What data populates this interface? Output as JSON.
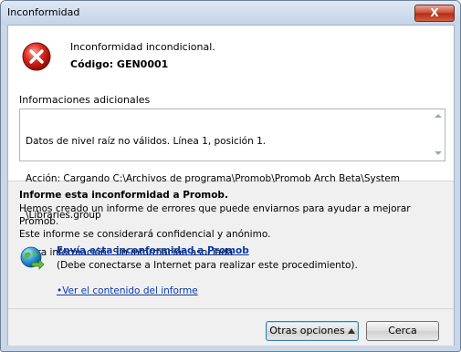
{
  "window": {
    "title": "Inconformidad",
    "close_label": "X"
  },
  "error": {
    "message": "Inconformidad incondicional.",
    "code": "Código: GEN0001"
  },
  "info": {
    "label": "Informaciones adicionales",
    "lines": [
      "Datos de nivel raíz no válidos. Línea 1, posición 1.",
      "Acción: Cargando C:\\Archivos de programa\\Promob\\Promob Arch Beta\\System",
      "\\Libraries.group",
      "Otra información: Sin información asociada"
    ]
  },
  "report": {
    "title": "Informe esta inconformidad a Promob.",
    "line1": "Hemos creado un informe de errores que puede enviarnos para ayudar a mejorar",
    "line2": "Promob.",
    "line3": "Este informe se considerará confidencial y anónimo.",
    "send_link": "Envía esta inconformidad a Promob",
    "send_note": "(Debe conectarse a Internet para realizar este procedimiento).",
    "view_link": "•Ver el contenido del informe"
  },
  "buttons": {
    "options": "Otras opciones",
    "cancel": "Cerca"
  }
}
